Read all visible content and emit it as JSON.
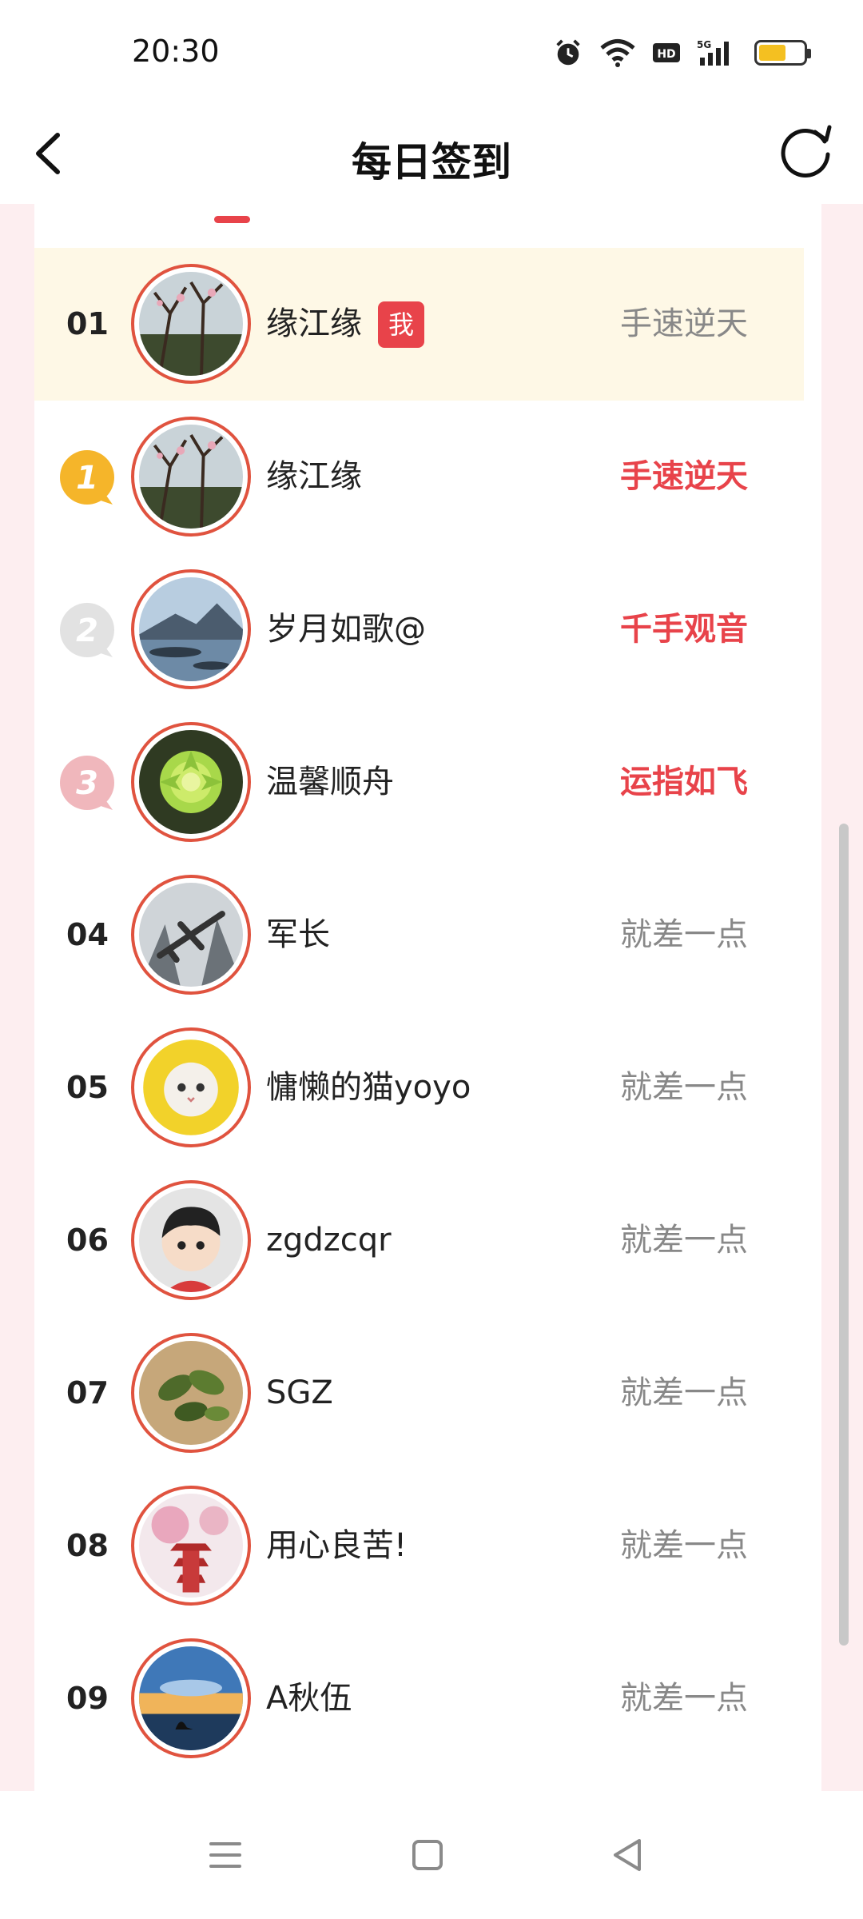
{
  "status": {
    "time": "20:30",
    "icons": [
      "alarm-icon",
      "wifi-icon",
      "hd-icon",
      "5g-signal-icon",
      "battery-icon"
    ],
    "battery_level": 0.62
  },
  "nav": {
    "title": "每日签到",
    "back_icon": "back-arrow-icon",
    "refresh_icon": "refresh-icon"
  },
  "colors": {
    "accent": "#e8434a",
    "highlight_row": "#fef8e6",
    "side_bg": "#fdeef0",
    "muted": "#888888"
  },
  "me_badge": "我",
  "leaderboard": [
    {
      "rank": "01",
      "name": "缘江缘",
      "title": "手速逆天",
      "is_me": true,
      "hot": false,
      "avatar": "plum-blossom-avatar"
    },
    {
      "rank": "1",
      "name": "缘江缘",
      "title": "手速逆天",
      "is_me": false,
      "hot": true,
      "medal": "gold",
      "avatar": "plum-blossom-avatar"
    },
    {
      "rank": "2",
      "name": "岁月如歌@",
      "title": "千手观音",
      "is_me": false,
      "hot": true,
      "medal": "silver",
      "avatar": "lake-mountain-avatar"
    },
    {
      "rank": "3",
      "name": "温馨顺舟",
      "title": "运指如飞",
      "is_me": false,
      "hot": true,
      "medal": "bronze",
      "avatar": "lotus-avatar"
    },
    {
      "rank": "04",
      "name": "军长",
      "title": "就差一点",
      "is_me": false,
      "hot": false,
      "avatar": "airplane-avatar"
    },
    {
      "rank": "05",
      "name": "慵懒的猫yoyo",
      "title": "就差一点",
      "is_me": false,
      "hot": false,
      "avatar": "cat-avatar"
    },
    {
      "rank": "06",
      "name": "zgdzcqr",
      "title": "就差一点",
      "is_me": false,
      "hot": false,
      "avatar": "cartoon-boy-avatar"
    },
    {
      "rank": "07",
      "name": "SGZ",
      "title": "就差一点",
      "is_me": false,
      "hot": false,
      "avatar": "leaves-avatar"
    },
    {
      "rank": "08",
      "name": "用心良苦!",
      "title": "就差一点",
      "is_me": false,
      "hot": false,
      "avatar": "pagoda-avatar"
    },
    {
      "rank": "09",
      "name": "A秋伍",
      "title": "就差一点",
      "is_me": false,
      "hot": false,
      "avatar": "sunset-avatar"
    }
  ],
  "bottom_nav": [
    "menu-icon",
    "home-icon",
    "back-triangle-icon"
  ]
}
